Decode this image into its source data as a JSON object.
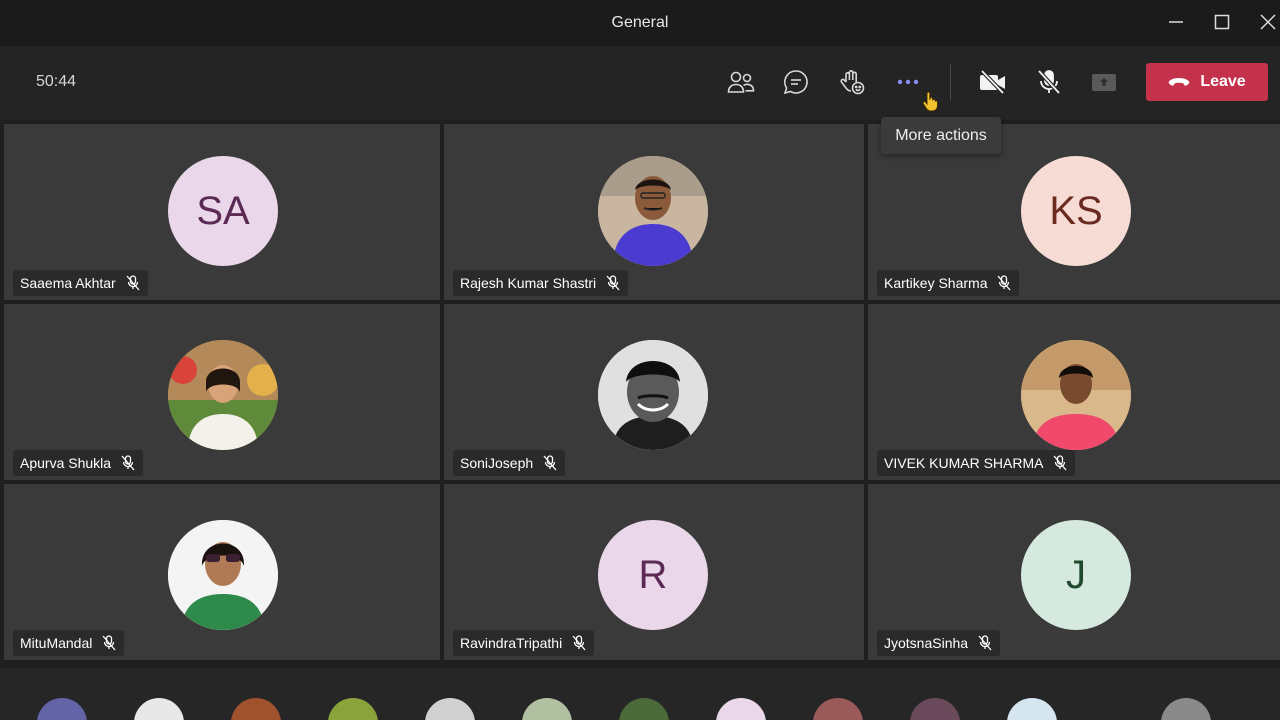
{
  "window": {
    "title": "General"
  },
  "toolbar": {
    "timer": "50:44",
    "leave_label": "Leave",
    "tooltip": "More actions",
    "icons": [
      "people-icon",
      "chat-icon",
      "raise-hand-icon",
      "more-actions-icon",
      "camera-off-icon",
      "mic-off-icon",
      "share-icon"
    ]
  },
  "participants": [
    {
      "name": "Saaema Akhtar",
      "initials": "SA",
      "muted": true
    },
    {
      "name": "Rajesh Kumar Shastri",
      "initials": "",
      "muted": true
    },
    {
      "name": "Kartikey Sharma",
      "initials": "KS",
      "muted": true
    },
    {
      "name": "Apurva Shukla",
      "initials": "",
      "muted": true
    },
    {
      "name": "SoniJoseph",
      "initials": "",
      "muted": true
    },
    {
      "name": "VIVEK KUMAR SHARMA",
      "initials": "",
      "muted": true
    },
    {
      "name": "MituMandal",
      "initials": "",
      "muted": true
    },
    {
      "name": "RavindraTripathi",
      "initials": "R",
      "muted": true
    },
    {
      "name": "JyotsnaSinha",
      "initials": "J",
      "muted": true
    }
  ],
  "colors": {
    "leave": "#c4314b",
    "accent": "#8b8cf7",
    "avatar_pink": "#ead7e9",
    "avatar_peach": "#f6dcd5",
    "avatar_green": "#d6e9de"
  }
}
